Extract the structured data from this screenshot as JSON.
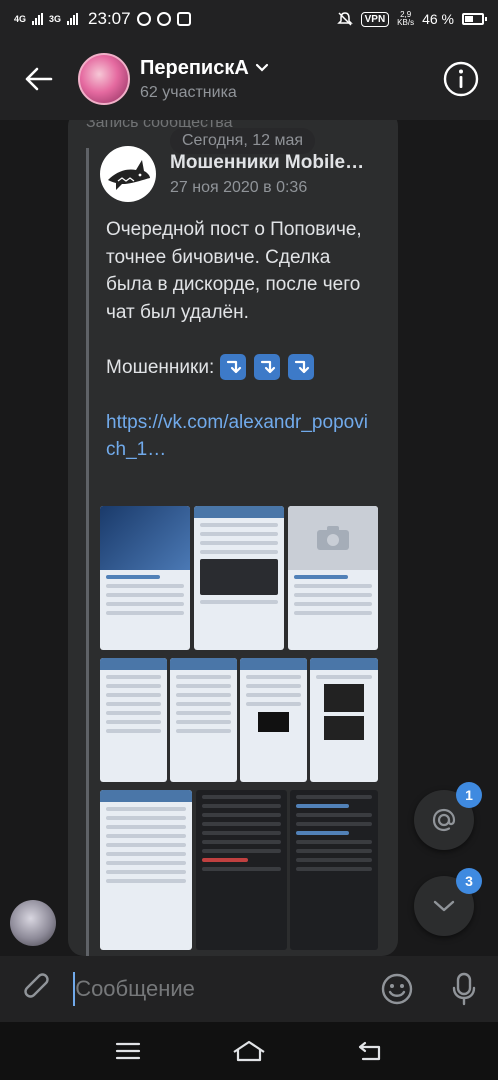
{
  "status_bar": {
    "net1": "4G",
    "net2": "3G",
    "time": "23:07",
    "vpn": "VPN",
    "speed_value": "2,9",
    "speed_unit": "KB/s",
    "battery": "46 %"
  },
  "header": {
    "title": "ПерепискА",
    "subtitle": "62 участника"
  },
  "message": {
    "community_label": "Запись сообщества",
    "date_chip": "Сегодня, 12 мая",
    "post": {
      "author": "Мошенники Mobile…",
      "date": "27 ноя 2020 в 0:36",
      "text_para1": "Очередной пост о Поповиче, точнее бичовиче. Сделка была в дискорде, после чего чат был удалён.",
      "text_para2": "Мошенники:",
      "link": "https://vk.com/alexandr_popovich_1…"
    }
  },
  "fabs": {
    "mentions_count": "1",
    "scroll_down_count": "3"
  },
  "composer": {
    "placeholder": "Сообщение"
  },
  "colors": {
    "accent": "#71aaeb",
    "badge": "#3f8ae0",
    "background": "#19191a",
    "bubble": "#2c2d2e"
  },
  "icons": [
    "back-arrow-icon",
    "chevron-down-icon",
    "info-icon",
    "at-icon",
    "chevron-down-icon",
    "paperclip-icon",
    "emoji-icon",
    "microphone-icon",
    "menu-icon",
    "home-icon",
    "back-icon"
  ]
}
